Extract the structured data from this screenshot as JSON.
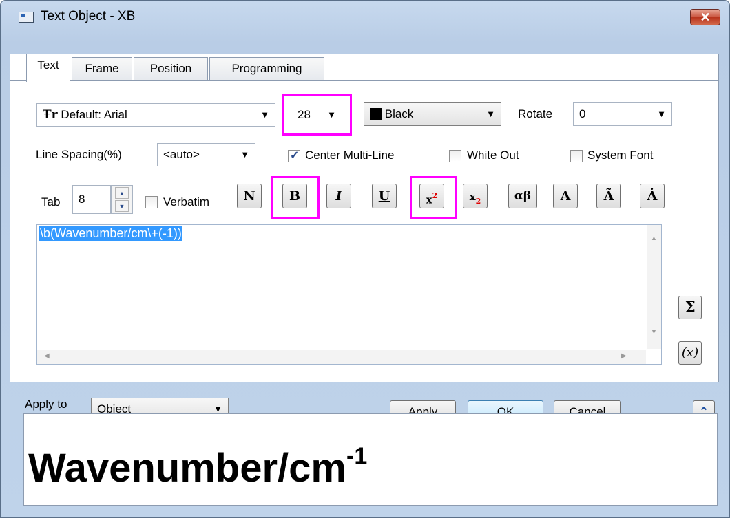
{
  "title": "Text Object - XB",
  "close_label": "✕",
  "tabs": [
    "Text",
    "Frame",
    "Position",
    "Programming"
  ],
  "font": {
    "icon": "Ŧr",
    "value": "Default: Arial"
  },
  "size": "28",
  "color": {
    "swatch": "#000000",
    "value": "Black"
  },
  "rotate": {
    "label": "Rotate",
    "value": "0"
  },
  "line_spacing": {
    "label": "Line Spacing(%)",
    "value": "<auto>"
  },
  "center_multiline": {
    "label": "Center Multi-Line",
    "checked": true
  },
  "white_out": {
    "label": "White Out",
    "checked": false
  },
  "system_font": {
    "label": "System Font",
    "checked": false
  },
  "tab": {
    "label": "Tab",
    "value": "8"
  },
  "verbatim": {
    "label": "Verbatim",
    "checked": false
  },
  "format_buttons": {
    "normal": "N",
    "bold": "B",
    "italic": "I",
    "underline": "U",
    "superscript_base": "x",
    "superscript_exp": "2",
    "subscript_base": "x",
    "subscript_exp": "2",
    "greek": "αβ",
    "overbar": "A",
    "tilde": "Ã",
    "dot": "Ȧ"
  },
  "editor_text": "\\b(Wavenumber/cm\\+(-1))",
  "side_buttons": {
    "sigma": "Σ",
    "function": "(x)"
  },
  "apply_to": {
    "label": "Apply to",
    "value": "Object"
  },
  "buttons": {
    "apply": "Apply",
    "ok": "OK",
    "cancel": "Cancel",
    "expand": "⌃"
  },
  "preview": {
    "base": "Wavenumber/cm",
    "superscript": "-1"
  },
  "highlight_color": "#ff00ff"
}
